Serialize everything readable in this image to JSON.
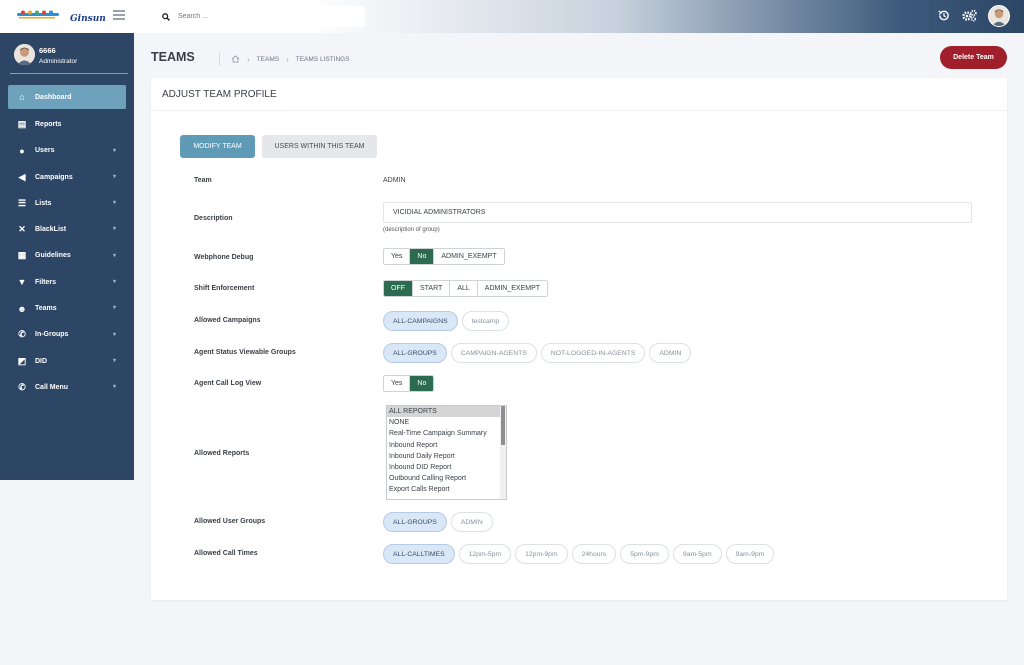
{
  "topbar": {
    "logo_text": "Ginsun",
    "search_placeholder": "Search ..."
  },
  "user": {
    "name": "6666",
    "role": "Administrator"
  },
  "sidebar": {
    "items": [
      {
        "label": "Dashboard",
        "icon": "home-icon",
        "glyph": "⌂",
        "active": true,
        "has_caret": false
      },
      {
        "label": "Reports",
        "icon": "file-icon",
        "glyph": "▤",
        "active": false,
        "has_caret": false
      },
      {
        "label": "Users",
        "icon": "user-icon",
        "glyph": "●",
        "active": false,
        "has_caret": true
      },
      {
        "label": "Campaigns",
        "icon": "megaphone-icon",
        "glyph": "◀",
        "active": false,
        "has_caret": true
      },
      {
        "label": "Lists",
        "icon": "list-icon",
        "glyph": "☰",
        "active": false,
        "has_caret": true
      },
      {
        "label": "BlackList",
        "icon": "phone-slash-icon",
        "glyph": "✕",
        "active": false,
        "has_caret": true
      },
      {
        "label": "Guidelines",
        "icon": "card-icon",
        "glyph": "▦",
        "active": false,
        "has_caret": true
      },
      {
        "label": "Filters",
        "icon": "filter-icon",
        "glyph": "▼",
        "active": false,
        "has_caret": true
      },
      {
        "label": "Teams",
        "icon": "users-icon",
        "glyph": "☻",
        "active": false,
        "has_caret": true
      },
      {
        "label": "In-Groups",
        "icon": "phone-icon",
        "glyph": "✆",
        "active": false,
        "has_caret": true
      },
      {
        "label": "DID",
        "icon": "chart-icon",
        "glyph": "◩",
        "active": false,
        "has_caret": true
      },
      {
        "label": "Call Menu",
        "icon": "phone-volume-icon",
        "glyph": "✆",
        "active": false,
        "has_caret": true
      }
    ]
  },
  "header": {
    "title": "TEAMS",
    "breadcrumb": [
      "TEAMS",
      "TEAMS LISTINGS"
    ],
    "delete_label": "Delete Team"
  },
  "card": {
    "title": "ADJUST TEAM PROFILE",
    "tabs": [
      "MODIFY TEAM",
      "USERS WITHIN THIS TEAM"
    ],
    "team_label": "Team",
    "team_value": "ADMIN",
    "description_label": "Description",
    "description_value": "VICIDIAL ADMINISTRATORS",
    "description_hint": "(description of group)",
    "webphone_label": "Webphone Debug",
    "webphone_options": [
      "Yes",
      "No",
      "ADMIN_EXEMPT"
    ],
    "webphone_selected": "No",
    "shift_label": "Shift Enforcement",
    "shift_options": [
      "OFF",
      "START",
      "ALL",
      "ADMIN_EXEMPT"
    ],
    "shift_selected": "OFF",
    "campaigns_label": "Allowed Campaigns",
    "campaigns": [
      {
        "label": "ALL-CAMPAIGNS",
        "on": true
      },
      {
        "label": "testcamp",
        "on": false
      }
    ],
    "status_groups_label": "Agent Status Viewable Groups",
    "status_groups": [
      {
        "label": "ALL-GROUPS",
        "on": true
      },
      {
        "label": "CAMPAIGN-AGENTS",
        "on": false
      },
      {
        "label": "NOT-LOGGED-IN-AGENTS",
        "on": false
      },
      {
        "label": "ADMIN",
        "on": false
      }
    ],
    "call_log_label": "Agent Call Log View",
    "call_log_options": [
      "Yes",
      "No"
    ],
    "call_log_selected": "No",
    "reports_label": "Allowed Reports",
    "reports": [
      {
        "label": "ALL REPORTS",
        "selected": true
      },
      {
        "label": "NONE",
        "selected": false
      },
      {
        "label": "Real-Time Campaign Summary",
        "selected": false
      },
      {
        "label": "Inbound Report",
        "selected": false
      },
      {
        "label": "Inbound Daily Report",
        "selected": false
      },
      {
        "label": "Inbound DID Report",
        "selected": false
      },
      {
        "label": "Outbound Calling Report",
        "selected": false
      },
      {
        "label": "Export Calls Report",
        "selected": false
      }
    ],
    "user_groups_label": "Allowed User Groups",
    "user_groups": [
      {
        "label": "ALL-GROUPS",
        "on": true
      },
      {
        "label": "ADMIN",
        "on": false
      }
    ],
    "call_times_label": "Allowed Call Times",
    "call_times": [
      {
        "label": "ALL-CALLTIMES",
        "on": true
      },
      {
        "label": "12pm-5pm",
        "on": false
      },
      {
        "label": "12pm-9pm",
        "on": false
      },
      {
        "label": "24hours",
        "on": false
      },
      {
        "label": "5pm-9pm",
        "on": false
      },
      {
        "label": "9am-5pm",
        "on": false
      },
      {
        "label": "9am-9pm",
        "on": false
      }
    ]
  },
  "colors": {
    "sidebar_bg": "#2e4665",
    "active_item": "#6ea2bc",
    "toggle_on": "#2d6b50",
    "delete_button": "#a01f2a",
    "pill_on": "#d9e7f7"
  }
}
